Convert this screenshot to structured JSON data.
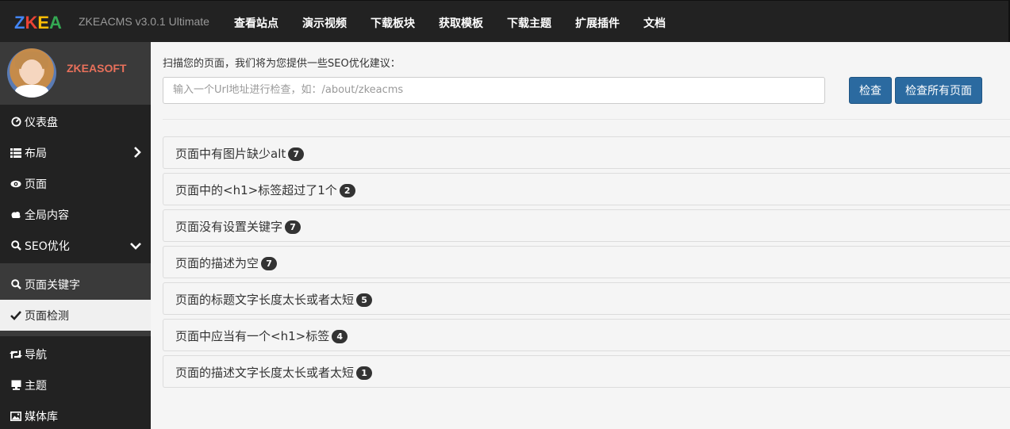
{
  "header": {
    "brand_letters": [
      {
        "char": "Z",
        "color": "#4285f4"
      },
      {
        "char": "K",
        "color": "#ea4335"
      },
      {
        "char": "E",
        "color": "#fbbc05"
      },
      {
        "char": "A",
        "color": "#34a853"
      }
    ],
    "version": "ZKEACMS v3.0.1 Ultimate",
    "nav": [
      "查看站点",
      "演示视频",
      "下载板块",
      "获取模板",
      "下载主题",
      "扩展插件",
      "文档"
    ]
  },
  "sidebar": {
    "profile_name": "ZKEASOFT",
    "items": [
      {
        "label": "仪表盘",
        "icon": "dashboard-icon"
      },
      {
        "label": "布局",
        "icon": "layout-icon",
        "chevron": "chevron-right-icon"
      },
      {
        "label": "页面",
        "icon": "eye-icon"
      },
      {
        "label": "全局内容",
        "icon": "cloud-icon"
      },
      {
        "label": "SEO优化",
        "icon": "search-icon",
        "chevron": "chevron-down-icon"
      },
      {
        "label": "页面关键字",
        "icon": "search-icon"
      },
      {
        "label": "页面检测",
        "icon": "check-icon"
      },
      {
        "label": "导航",
        "icon": "retweet-icon"
      },
      {
        "label": "主题",
        "icon": "monitor-icon"
      },
      {
        "label": "媒体库",
        "icon": "picture-icon"
      }
    ]
  },
  "main": {
    "hint": "扫描您的页面，我们将为您提供一些SEO优化建议：",
    "url_placeholder": "输入一个Url地址进行检查，如：/about/zkeacms",
    "check_label": "检查",
    "check_all_label": "检查所有页面",
    "issues": [
      {
        "title": "页面中有图片缺少alt",
        "count": "7"
      },
      {
        "title": "页面中的<h1>标签超过了1个",
        "count": "2"
      },
      {
        "title": "页面没有设置关键字",
        "count": "7"
      },
      {
        "title": "页面的描述为空",
        "count": "7"
      },
      {
        "title": "页面的标题文字长度太长或者太短",
        "count": "5"
      },
      {
        "title": "页面中应当有一个<h1>标签",
        "count": "4"
      },
      {
        "title": "页面的描述文字长度太长或者太短",
        "count": "1"
      }
    ]
  }
}
